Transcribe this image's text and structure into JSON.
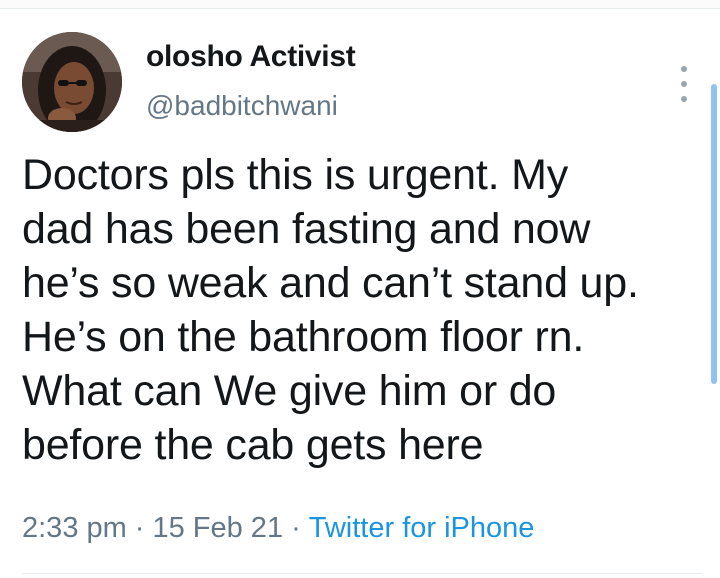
{
  "tweet": {
    "author": {
      "display_name": "olosho Activist",
      "handle": "@badbitchwani",
      "avatar_icon": "profile-photo"
    },
    "text_lines": [
      "Doctors pls this is urgent. My",
      "dad has been fasting and now",
      "he’s so weak and can’t stand up.",
      "He’s on the bathroom floor rn.",
      "What can We give him or do",
      "before the cab gets here"
    ],
    "time": "2:33 pm",
    "date": "15 Feb 21",
    "separator": "·",
    "source": "Twitter for iPhone",
    "more_icon": "vertical-ellipsis-icon"
  },
  "colors": {
    "text": "#14171a",
    "muted": "#657786",
    "link": "#1b95e0",
    "scroll_indicator": "#8fc3f2"
  }
}
